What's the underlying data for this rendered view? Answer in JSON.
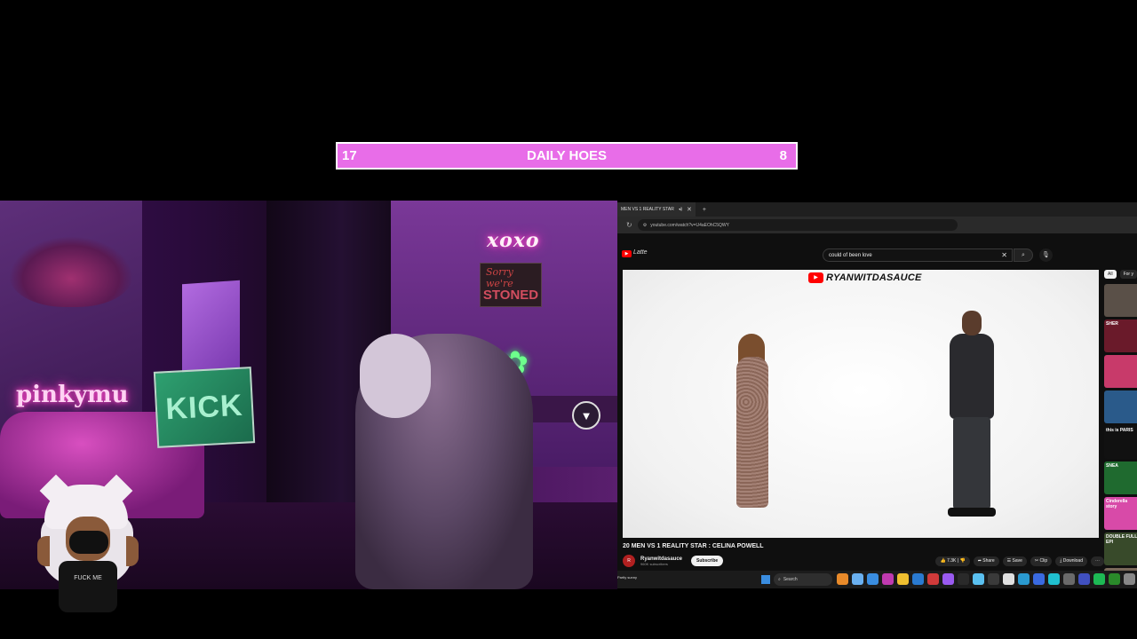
{
  "goal_bar": {
    "left_count": "17",
    "title": "DAILY HOES",
    "right_count": "8",
    "color": "#e86de8"
  },
  "webcam": {
    "neon_left": "pinkymu",
    "kick_sign": "KICK",
    "neon_xoxo": "xoxo",
    "stoned_script": "Sorry we're",
    "stoned_text": "STONED",
    "leaf_icon": "cannabis-leaf-icon"
  },
  "avatar": {
    "shirt_text": "FUCK ME"
  },
  "browser": {
    "tab_title": "MEN VS 1 REALITY STAR",
    "url": "youtube.com/watch?v=U4aEOhC5QWY",
    "yt_logo_text": "Latte",
    "search_value": "could of been love",
    "player": {
      "watermark": "RYANWITDASAUCE"
    },
    "video_title": "20 MEN VS 1 REALITY STAR : CELINA POWELL",
    "channel": {
      "name": "Ryanwitdasauce",
      "subs": "960K subscribers",
      "subscribe_label": "Subscribe"
    },
    "actions": {
      "likes": "7.3K",
      "share": "Share",
      "save": "Save",
      "clip": "Clip",
      "download": "Download",
      "more": "⋯"
    },
    "chips": [
      "All",
      "For y"
    ],
    "thumbnails": [
      {
        "label": "",
        "color": "#5a5048"
      },
      {
        "label": "SHER",
        "color": "#6a1a2a"
      },
      {
        "label": "",
        "color": "#c83a6a"
      },
      {
        "label": "",
        "color": "#2a5a8a"
      },
      {
        "label": "this is PARIS",
        "color": "#111111"
      },
      {
        "label": "SNEA",
        "color": "#1f6a2f"
      },
      {
        "label": "Cinderella story",
        "color": "#d84aa8"
      },
      {
        "label": "DOUBLE FULL EPI",
        "color": "#384a2a"
      },
      {
        "label": "",
        "color": "#7a6a5a"
      }
    ]
  },
  "taskbar": {
    "weather": "Partly sunny",
    "search_label": "Search",
    "app_colors": [
      "#e88a2a",
      "#6ab0f0",
      "#3a8de0",
      "#c03ab0",
      "#f0c030",
      "#2a7ad0",
      "#d03a3a",
      "#9a5af0",
      "#2a2a2a",
      "#5ac0f0",
      "#3a3a3a",
      "#e0e0e0",
      "#2a9ad0",
      "#3a6ae0",
      "#20c0d0",
      "#6a6a6a",
      "#4050c0",
      "#1db954",
      "#2a8a2a",
      "#888888",
      "#e040a0",
      "#d0d0d0",
      "#e83a3a"
    ]
  }
}
